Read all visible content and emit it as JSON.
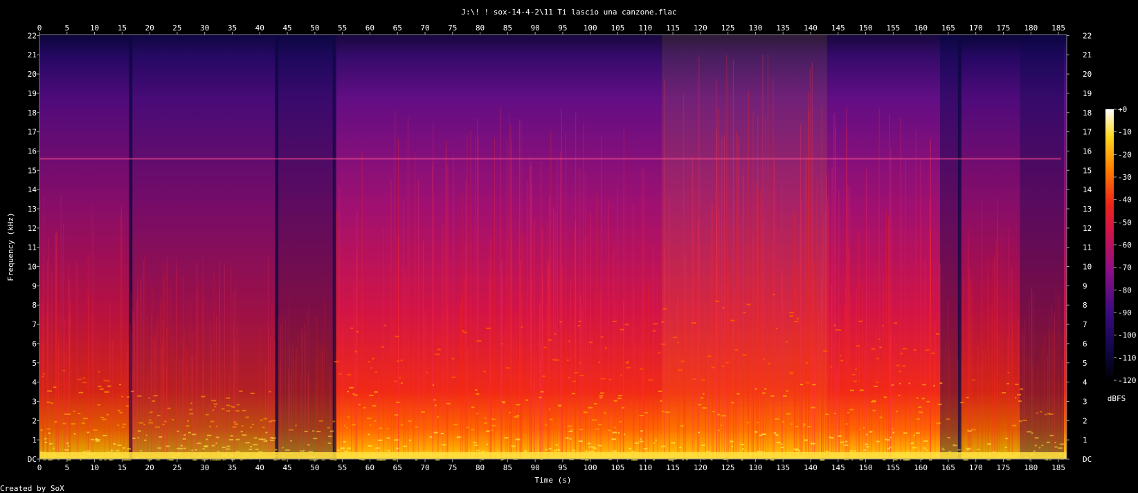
{
  "title": "J:\\! ! sox-14-4-2\\11 Ti lascio una canzone.flac",
  "footer": "Created by SoX",
  "chart_data": {
    "type": "heatmap",
    "xlabel": "Time (s)",
    "ylabel": "Frequency (kHz)",
    "xlim": [
      0,
      186.5
    ],
    "ylim": [
      0,
      22.05
    ],
    "x_ticks": [
      "0",
      "5",
      "10",
      "15",
      "20",
      "25",
      "30",
      "35",
      "40",
      "45",
      "50",
      "55",
      "60",
      "65",
      "70",
      "75",
      "80",
      "85",
      "90",
      "95",
      "100",
      "105",
      "110",
      "115",
      "120",
      "125",
      "130",
      "135",
      "140",
      "145",
      "150",
      "155",
      "160",
      "165",
      "170",
      "175",
      "180",
      "185"
    ],
    "y_ticks": [
      "DC",
      "1",
      "2",
      "3",
      "4",
      "5",
      "6",
      "7",
      "8",
      "9",
      "10",
      "11",
      "12",
      "13",
      "14",
      "15",
      "16",
      "17",
      "18",
      "19",
      "20",
      "21",
      "22"
    ],
    "colorbar": {
      "label": "dBFS",
      "range": [
        -120,
        0
      ],
      "ticks": [
        "+0",
        "-10",
        "-20",
        "-30",
        "-40",
        "-50",
        "-60",
        "-70",
        "-80",
        "-90",
        "-100",
        "-110",
        "-120"
      ]
    },
    "colors": {
      "black": "#000000",
      "deep_blue": "#0b0740",
      "purple": "#5a0e8a",
      "magenta": "#b0126e",
      "red": "#e81a1e",
      "orange": "#ff7a00",
      "yellow": "#ffdc20",
      "white": "#ffffff"
    },
    "energy_profile_seconds": [
      {
        "start": 0,
        "end": 16.5,
        "level": "medium"
      },
      {
        "start": 16.5,
        "end": 43.0,
        "level": "medium-low"
      },
      {
        "start": 43.0,
        "end": 53.5,
        "level": "low"
      },
      {
        "start": 53.5,
        "end": 113.0,
        "level": "high"
      },
      {
        "start": 113.0,
        "end": 143.0,
        "level": "very-high"
      },
      {
        "start": 143.0,
        "end": 163.5,
        "level": "high"
      },
      {
        "start": 163.5,
        "end": 167.0,
        "level": "low"
      },
      {
        "start": 167.0,
        "end": 178.0,
        "level": "medium"
      },
      {
        "start": 178.0,
        "end": 186.0,
        "level": "fade-out"
      }
    ],
    "gaps_seconds": [
      16.5,
      43.0,
      53.5,
      167.0
    ],
    "steady_tone_khz": 15.6
  }
}
